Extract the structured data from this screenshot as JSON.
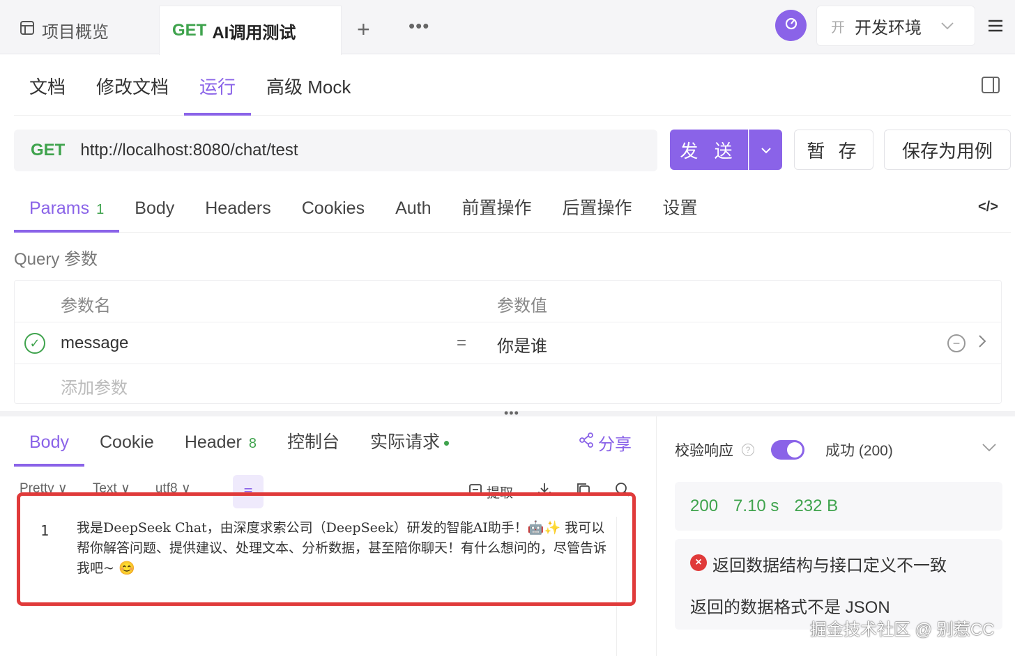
{
  "top_tabs": {
    "overview_label": "项目概览",
    "active_method": "GET",
    "active_label": "AI调用测试",
    "new_tab": "+",
    "more": "•••"
  },
  "environment": {
    "tag": "开",
    "name": "开发环境"
  },
  "sub_tabs": [
    "文档",
    "修改文档",
    "运行",
    "高级 Mock"
  ],
  "active_sub_tab": "运行",
  "request": {
    "method": "GET",
    "url": "http://localhost:8080/chat/test",
    "send_label": "发 送",
    "save_label": "暂 存",
    "save_case_label": "保存为用例"
  },
  "param_tabs": [
    {
      "label": "Params",
      "count": "1"
    },
    {
      "label": "Body",
      "count": ""
    },
    {
      "label": "Headers",
      "count": ""
    },
    {
      "label": "Cookies",
      "count": ""
    },
    {
      "label": "Auth",
      "count": ""
    },
    {
      "label": "前置操作",
      "count": ""
    },
    {
      "label": "后置操作",
      "count": ""
    },
    {
      "label": "设置",
      "count": ""
    }
  ],
  "query": {
    "section_label": "Query 参数",
    "col_name": "参数名",
    "col_value": "参数值",
    "rows": [
      {
        "name": "message",
        "eq": "=",
        "value": "你是谁"
      }
    ],
    "add_placeholder": "添加参数"
  },
  "response_tabs": [
    {
      "label": "Body",
      "count": ""
    },
    {
      "label": "Cookie",
      "count": ""
    },
    {
      "label": "Header",
      "count": "8"
    },
    {
      "label": "控制台",
      "count": ""
    },
    {
      "label": "实际请求",
      "count": ""
    }
  ],
  "share_label": "分享",
  "format_bar": {
    "pretty": "Pretty",
    "text": "Text",
    "encoding": "utf8",
    "extract": "提取"
  },
  "response_body": {
    "line_number": "1",
    "content": "我是DeepSeek Chat，由深度求索公司（DeepSeek）研发的智能AI助手！🤖✨ 我可以帮你解答问题、提供建议、处理文本、分析数据，甚至陪你聊天！有什么想问的，尽管告诉我吧~ 😊"
  },
  "verify": {
    "label": "校验响应",
    "enabled": true,
    "status": "成功 (200)"
  },
  "metrics": {
    "code": "200",
    "time": "7.10 s",
    "size": "232 B"
  },
  "validation_error": {
    "title": "返回数据结构与接口定义不一致",
    "detail": "返回的数据格式不是 JSON"
  },
  "watermark": "掘金技术社区 @ 别惹CC",
  "colors": {
    "accent": "#8a63e8",
    "success": "#3fa34d",
    "error": "#e03a3a"
  }
}
